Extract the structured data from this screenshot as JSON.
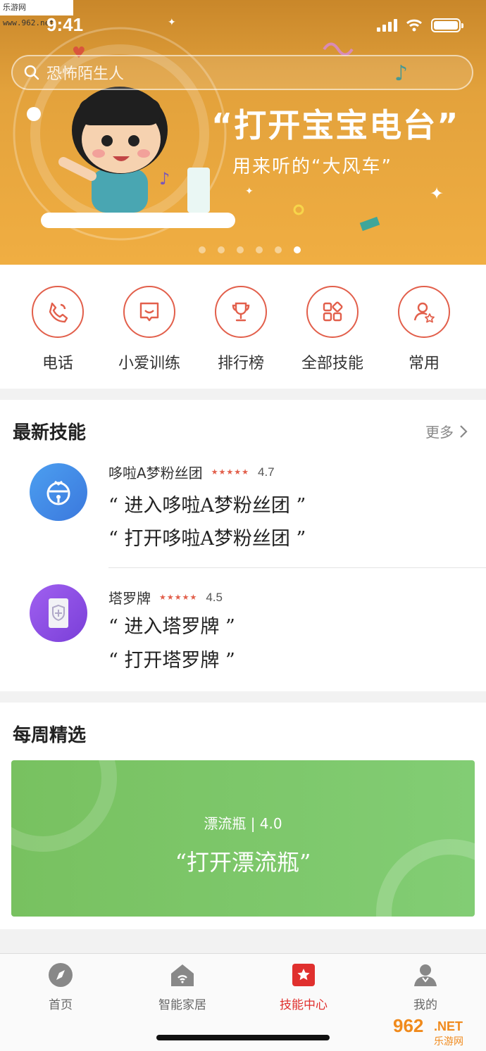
{
  "watermark": "乐游网 www.962.net",
  "status": {
    "time": "9:41"
  },
  "search": {
    "placeholder": "恐怖陌生人"
  },
  "banner": {
    "title": "“打开宝宝电台”",
    "subtitle": "用来听的“大风车”",
    "pages": 6,
    "active_page": 6
  },
  "quick_actions": [
    {
      "label": "电话",
      "icon": "phone-icon"
    },
    {
      "label": "小爱训练",
      "icon": "chat-bubble-icon"
    },
    {
      "label": "排行榜",
      "icon": "trophy-icon"
    },
    {
      "label": "全部技能",
      "icon": "grid-icon"
    },
    {
      "label": "常用",
      "icon": "user-star-icon"
    }
  ],
  "latest": {
    "title": "最新技能",
    "more": "更多",
    "skills": [
      {
        "name": "哆啦A梦粉丝团",
        "rating": "4.7",
        "stars": 4.7,
        "utter1": "“ 进入哆啦A梦粉丝团 ”",
        "utter2": "“ 打开哆啦A梦粉丝团 ”",
        "icon": "bell-icon",
        "color": "#3f86e6"
      },
      {
        "name": "塔罗牌",
        "rating": "4.5",
        "stars": 4.5,
        "utter1": "“ 进入塔罗牌 ”",
        "utter2": "“ 打开塔罗牌 ”",
        "icon": "card-icon",
        "color": "#8b4de0"
      }
    ]
  },
  "weekly": {
    "title": "每周精选",
    "card_meta": "漂流瓶 | 4.0",
    "card_quote": "“打开漂流瓶”"
  },
  "tabs": [
    {
      "label": "首页",
      "icon": "compass-icon",
      "active": false
    },
    {
      "label": "智能家居",
      "icon": "smart-home-icon",
      "active": false
    },
    {
      "label": "技能中心",
      "icon": "skill-star-icon",
      "active": true
    },
    {
      "label": "我的",
      "icon": "profile-icon",
      "active": false
    }
  ],
  "corner_logo": "962.NET 乐游网",
  "colors": {
    "accent": "#e25f4b",
    "active_tab": "#e0302e",
    "banner": "#f0ae42",
    "card": "#7cc668"
  }
}
